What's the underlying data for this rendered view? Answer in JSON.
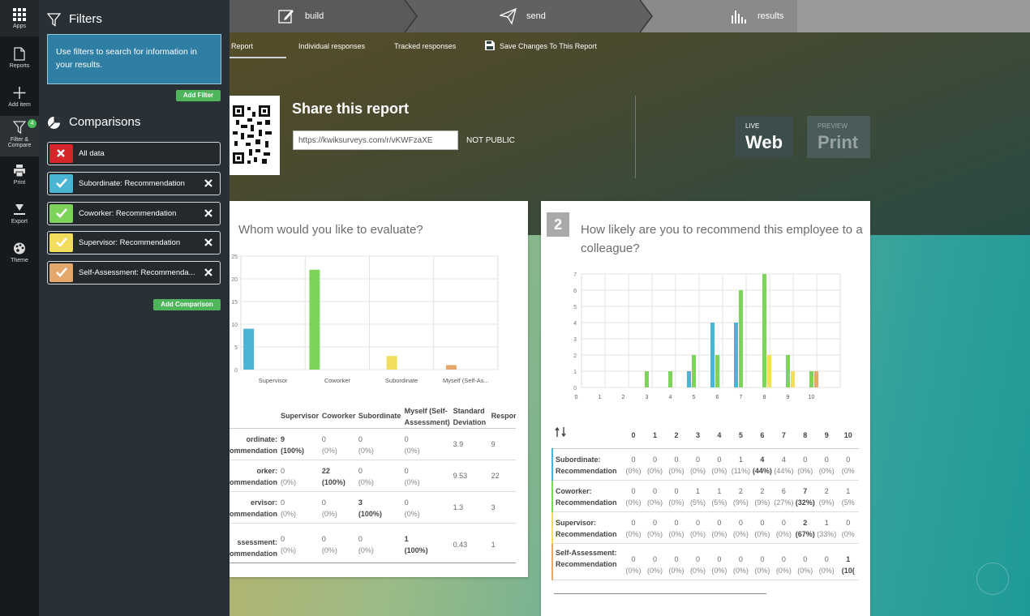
{
  "iconbar": [
    {
      "label": "Apps",
      "icon": "apps-grid-icon"
    },
    {
      "label": "Reports",
      "icon": "document-icon"
    },
    {
      "label": "Add item",
      "icon": "plus-icon"
    },
    {
      "label": "Filter &",
      "label2": "Compare",
      "icon": "filter-icon",
      "badge": "4"
    },
    {
      "label": "Print",
      "icon": "printer-icon"
    },
    {
      "label": "Export",
      "icon": "download-icon"
    },
    {
      "label": "Theme",
      "icon": "palette-icon"
    }
  ],
  "filters": {
    "title": "Filters",
    "info": "Use filters to search for information in your results.",
    "add_label": "Add Filter"
  },
  "comparisons": {
    "title": "Comparisons",
    "add_label": "Add Comparison",
    "items": [
      {
        "label": "All data",
        "color": "#d7262b",
        "checked": false
      },
      {
        "label": "Subordinate: Recommendation",
        "color": "#4ab5d2",
        "checked": true
      },
      {
        "label": "Coworker: Recommendation",
        "color": "#7ed35b",
        "checked": true
      },
      {
        "label": "Supervisor: Recommendation",
        "color": "#f2dd5c",
        "checked": true
      },
      {
        "label": "Self-Assessment: Recommenda...",
        "color": "#e5a86c",
        "checked": true
      }
    ]
  },
  "steps": [
    {
      "label": "build",
      "icon": "pencil-icon"
    },
    {
      "label": "send",
      "icon": "paper-plane-icon"
    },
    {
      "label": "results",
      "icon": "bar-chart-icon"
    }
  ],
  "tabs": [
    "Report",
    "Individual responses",
    "Tracked responses",
    "Save Changes To This Report"
  ],
  "share": {
    "title": "Share this report",
    "url": "https://kwiksurveys.com/r/vKWFzaXE",
    "visibility": "NOT PUBLIC"
  },
  "view_buttons": [
    {
      "small": "LIVE",
      "big": "Web"
    },
    {
      "small": "PREVIEW",
      "big": "Print"
    }
  ],
  "q1": {
    "title": "Whom would you like to evaluate?",
    "headers": [
      "Supervisor",
      "Coworker",
      "Subordinate",
      "Myself (Self-Assessment)",
      "Standard Deviation",
      "Respor"
    ],
    "rows": [
      {
        "label": "ordinate: ommendation",
        "cells": [
          {
            "n": "9",
            "p": "(100%)"
          },
          {
            "n": "0",
            "p": "(0%)"
          },
          {
            "n": "0",
            "p": "(0%)"
          },
          {
            "n": "0",
            "p": "(0%)"
          }
        ],
        "sd": "3.9",
        "resp": "9"
      },
      {
        "label": "orker: ommendation",
        "cells": [
          {
            "n": "0",
            "p": "(0%)"
          },
          {
            "n": "22",
            "p": "(100%)"
          },
          {
            "n": "0",
            "p": "(0%)"
          },
          {
            "n": "0",
            "p": "(0%)"
          }
        ],
        "sd": "9.53",
        "resp": "22"
      },
      {
        "label": "ervisor: ommendation",
        "cells": [
          {
            "n": "0",
            "p": "(0%)"
          },
          {
            "n": "0",
            "p": "(0%)"
          },
          {
            "n": "3",
            "p": "(100%)"
          },
          {
            "n": "0",
            "p": "(0%)"
          }
        ],
        "sd": "1.3",
        "resp": "3"
      },
      {
        "label": "ssessment: ommendation",
        "cells": [
          {
            "n": "0",
            "p": "(0%)"
          },
          {
            "n": "0",
            "p": "(0%)"
          },
          {
            "n": "0",
            "p": "(0%)"
          },
          {
            "n": "1",
            "p": "(100%)"
          }
        ],
        "sd": "0.43",
        "resp": "1"
      }
    ]
  },
  "q2": {
    "number": "2",
    "title": "How likely are you to recommend this employee to a colleague?",
    "headers": [
      "0",
      "1",
      "2",
      "3",
      "4",
      "5",
      "6",
      "7",
      "8",
      "9",
      "10"
    ],
    "rows": [
      {
        "label": "Subordinate: Recommendation",
        "color": "#4ab5d2",
        "n": [
          "0",
          "0",
          "0",
          "0",
          "0",
          "1",
          "4",
          "4",
          "0",
          "0",
          "0"
        ],
        "p": [
          "(0%)",
          "(0%)",
          "(0%)",
          "(0%)",
          "(0%)",
          "(11%)",
          "(44%)",
          "(44%)",
          "(0%)",
          "(0%)",
          "(0%"
        ],
        "bold": [
          6
        ]
      },
      {
        "label": "Coworker: Recommendation",
        "color": "#7ed35b",
        "n": [
          "0",
          "0",
          "0",
          "1",
          "1",
          "2",
          "2",
          "6",
          "7",
          "2",
          "1"
        ],
        "p": [
          "(0%)",
          "(0%)",
          "(0%)",
          "(5%)",
          "(5%)",
          "(9%)",
          "(9%)",
          "(27%)",
          "(32%)",
          "(9%)",
          "(5%"
        ],
        "bold": [
          8
        ]
      },
      {
        "label": "Supervisor: Recommendation",
        "color": "#f2dd5c",
        "n": [
          "0",
          "0",
          "0",
          "0",
          "0",
          "0",
          "0",
          "0",
          "2",
          "1",
          "0"
        ],
        "p": [
          "(0%)",
          "(0%)",
          "(0%)",
          "(0%)",
          "(0%)",
          "(0%)",
          "(0%)",
          "(0%)",
          "(67%)",
          "(33%)",
          "(0%"
        ],
        "bold": [
          8
        ]
      },
      {
        "label": "Self-Assessment: Recommendation",
        "color": "#e5a86c",
        "n": [
          "0",
          "0",
          "0",
          "0",
          "0",
          "0",
          "0",
          "0",
          "0",
          "0",
          "1"
        ],
        "p": [
          "(0%)",
          "(0%)",
          "(0%)",
          "(0%)",
          "(0%)",
          "(0%)",
          "(0%)",
          "(0%)",
          "(0%)",
          "(0%)",
          "(10("
        ],
        "bold": [
          10
        ]
      }
    ]
  },
  "chart_data": [
    {
      "type": "bar",
      "categories": [
        "Supervisor",
        "Coworker",
        "Subordinate",
        "Myself (Self-As..."
      ],
      "series": [
        {
          "name": "Subordinate: Recommendation",
          "color": "#4ab5d2",
          "values": [
            9,
            0,
            0,
            0
          ]
        },
        {
          "name": "Coworker: Recommendation",
          "color": "#7ed35b",
          "values": [
            0,
            22,
            0,
            0
          ]
        },
        {
          "name": "Supervisor: Recommendation",
          "color": "#f2dd5c",
          "values": [
            0,
            0,
            3,
            0
          ]
        },
        {
          "name": "Self-Assessment: Recommendation",
          "color": "#e5a86c",
          "values": [
            0,
            0,
            0,
            1
          ]
        }
      ],
      "yticks": [
        "0",
        "5",
        "10",
        "15",
        "20",
        "25"
      ],
      "ylim": [
        0,
        25
      ]
    },
    {
      "type": "bar",
      "categories": [
        "0",
        "1",
        "2",
        "3",
        "4",
        "5",
        "6",
        "7",
        "8",
        "9",
        "10"
      ],
      "series": [
        {
          "name": "Subordinate: Recommendation",
          "color": "#4ab5d2",
          "values": [
            0,
            0,
            0,
            0,
            0,
            1,
            4,
            4,
            0,
            0,
            0
          ]
        },
        {
          "name": "Coworker: Recommendation",
          "color": "#7ed35b",
          "values": [
            0,
            0,
            0,
            1,
            1,
            2,
            2,
            6,
            7,
            2,
            1
          ]
        },
        {
          "name": "Supervisor: Recommendation",
          "color": "#f2dd5c",
          "values": [
            0,
            0,
            0,
            0,
            0,
            0,
            0,
            0,
            2,
            1,
            0
          ]
        },
        {
          "name": "Self-Assessment: Recommendation",
          "color": "#e5a86c",
          "values": [
            0,
            0,
            0,
            0,
            0,
            0,
            0,
            0,
            0,
            0,
            1
          ]
        }
      ],
      "yticks": [
        "0",
        "1",
        "2",
        "3",
        "4",
        "5",
        "6",
        "7"
      ],
      "ylim": [
        0,
        7
      ]
    }
  ]
}
